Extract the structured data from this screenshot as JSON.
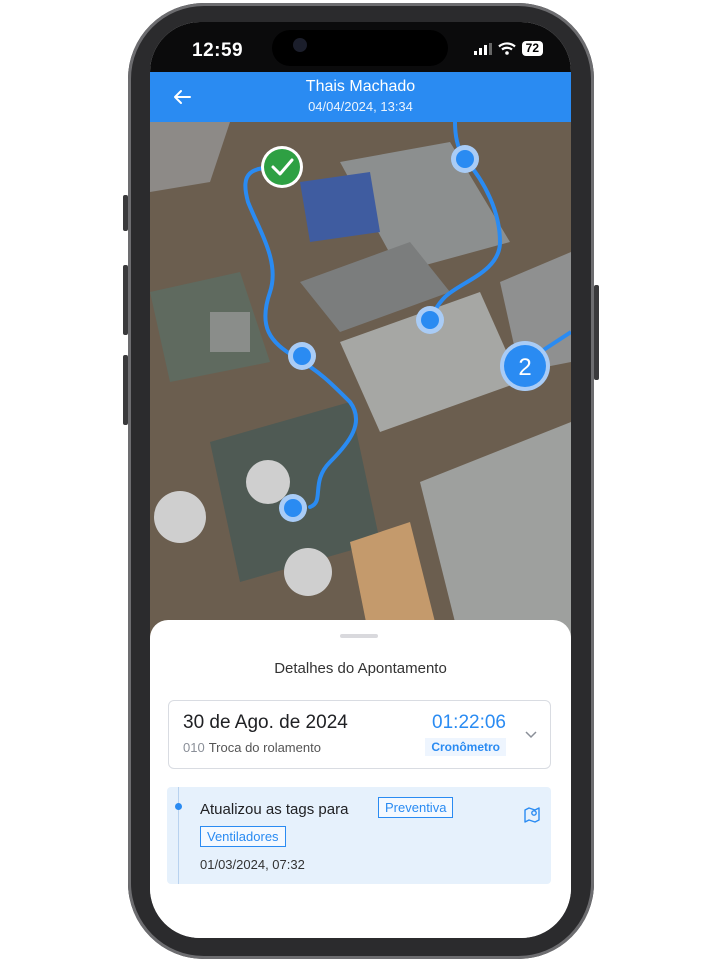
{
  "status_bar": {
    "time": "12:59",
    "battery": "72"
  },
  "header": {
    "title": "Thais Machado",
    "subtitle": "04/04/2024, 13:34"
  },
  "map": {
    "cluster_label": "2",
    "route_color": "#2a8bf2",
    "check_color": "#2ea043"
  },
  "sheet": {
    "title": "Detalhes do Apontamento",
    "card": {
      "date": "30 de Ago. de 2024",
      "code": "010",
      "description": "Troca do rolamento",
      "timer": "01:22:06",
      "timer_label": "Cronômetro"
    },
    "event": {
      "text": "Atualizou as tags para",
      "tags": [
        "Preventiva",
        "Ventiladores"
      ],
      "time": "01/03/2024, 07:32"
    }
  },
  "colors": {
    "accent": "#2a8bf2",
    "event_bg": "#e6f1fc"
  }
}
